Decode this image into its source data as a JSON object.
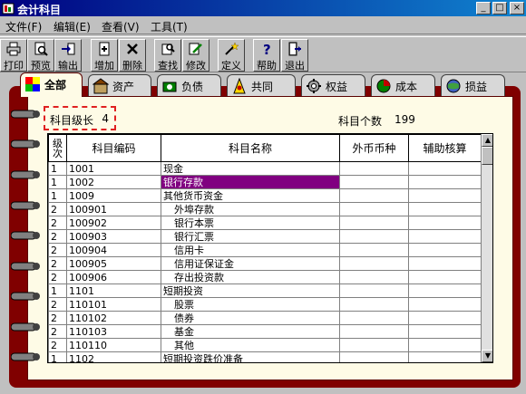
{
  "window": {
    "title": "会计科目",
    "min": "_",
    "max": "□",
    "close": "×"
  },
  "menu": [
    {
      "label": "文件(F)"
    },
    {
      "label": "编辑(E)"
    },
    {
      "label": "查看(V)"
    },
    {
      "label": "工具(T)"
    }
  ],
  "toolbar": [
    {
      "label": "打印",
      "icon": "printer-icon"
    },
    {
      "label": "预览",
      "icon": "preview-icon"
    },
    {
      "label": "输出",
      "icon": "export-icon"
    },
    {
      "label": "增加",
      "icon": "add-icon"
    },
    {
      "label": "删除",
      "icon": "delete-icon"
    },
    {
      "label": "查找",
      "icon": "find-icon"
    },
    {
      "label": "修改",
      "icon": "edit-icon"
    },
    {
      "label": "定义",
      "icon": "define-icon"
    },
    {
      "label": "帮助",
      "icon": "help-icon"
    },
    {
      "label": "退出",
      "icon": "exit-icon"
    }
  ],
  "tabs": [
    {
      "label": "全部",
      "icon": "all-icon",
      "active": true
    },
    {
      "label": "资产",
      "icon": "asset-icon"
    },
    {
      "label": "负债",
      "icon": "liability-icon"
    },
    {
      "label": "共同",
      "icon": "common-icon"
    },
    {
      "label": "权益",
      "icon": "equity-icon"
    },
    {
      "label": "成本",
      "icon": "cost-icon"
    },
    {
      "label": "损益",
      "icon": "profit-loss-icon"
    }
  ],
  "level": {
    "label": "科目级长",
    "value": "4"
  },
  "count": {
    "label": "科目个数",
    "value": "199"
  },
  "table": {
    "headers": {
      "level": "级次",
      "code": "科目编码",
      "name": "科目名称",
      "currency": "外币币种",
      "aux": "辅助核算"
    },
    "rows": [
      {
        "level": "1",
        "code": "1001",
        "name": "现金",
        "indent": false,
        "selected": false
      },
      {
        "level": "1",
        "code": "1002",
        "name": "银行存款",
        "indent": false,
        "selected": true
      },
      {
        "level": "1",
        "code": "1009",
        "name": "其他货币资金",
        "indent": false,
        "selected": false
      },
      {
        "level": "2",
        "code": "100901",
        "name": "外埠存款",
        "indent": true,
        "selected": false
      },
      {
        "level": "2",
        "code": "100902",
        "name": "银行本票",
        "indent": true,
        "selected": false
      },
      {
        "level": "2",
        "code": "100903",
        "name": "银行汇票",
        "indent": true,
        "selected": false
      },
      {
        "level": "2",
        "code": "100904",
        "name": "信用卡",
        "indent": true,
        "selected": false
      },
      {
        "level": "2",
        "code": "100905",
        "name": "信用证保证金",
        "indent": true,
        "selected": false
      },
      {
        "level": "2",
        "code": "100906",
        "name": "存出投资款",
        "indent": true,
        "selected": false
      },
      {
        "level": "1",
        "code": "1101",
        "name": "短期投资",
        "indent": false,
        "selected": false
      },
      {
        "level": "2",
        "code": "110101",
        "name": "股票",
        "indent": true,
        "selected": false
      },
      {
        "level": "2",
        "code": "110102",
        "name": "债券",
        "indent": true,
        "selected": false
      },
      {
        "level": "2",
        "code": "110103",
        "name": "基金",
        "indent": true,
        "selected": false
      },
      {
        "level": "2",
        "code": "110110",
        "name": "其他",
        "indent": true,
        "selected": false
      },
      {
        "level": "1",
        "code": "1102",
        "name": "短期投资跌价准备",
        "indent": false,
        "selected": false
      }
    ]
  },
  "colors": {
    "selection": "#800080",
    "book": "#800000",
    "page": "#fefbe6",
    "titlebar": "#000080"
  }
}
